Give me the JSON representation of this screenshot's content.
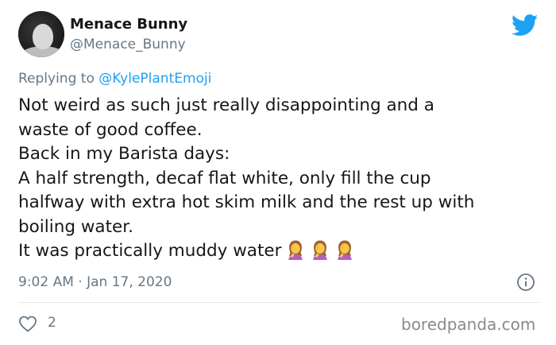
{
  "author": {
    "name": "Menace Bunny",
    "handle": "@Menace_Bunny"
  },
  "reply": {
    "prefix": "Replying to ",
    "target": "@KylePlantEmoji"
  },
  "tweet": {
    "lines": [
      "Not weird as such just really disappointing and a",
      "waste of good coffee.",
      "Back in my Barista days:",
      "A half strength, decaf flat white, only fill the cup",
      "halfway with extra hot skim milk and the rest up with",
      "boiling water.",
      "It was practically muddy water"
    ],
    "emoji": [
      "woman-facepalming-emoji",
      "woman-facepalming-emoji",
      "woman-facepalming-emoji"
    ]
  },
  "meta": {
    "timestamp": "9:02 AM · Jan 17, 2020"
  },
  "actions": {
    "like_count": "2"
  },
  "watermark": "boredpanda.com",
  "colors": {
    "twitter_blue": "#1da1f2",
    "secondary_text": "#657786",
    "primary_text": "#14171a",
    "divider": "#e1e8ed"
  }
}
